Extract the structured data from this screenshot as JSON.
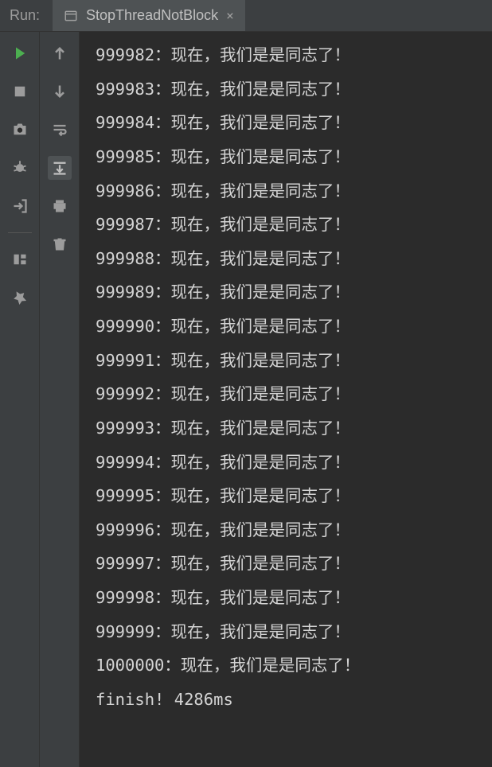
{
  "header": {
    "label": "Run:",
    "tab_title": "StopThreadNotBlock"
  },
  "console": {
    "lines": [
      "999982：现在，我们是是同志了！",
      "999983：现在，我们是是同志了！",
      "999984：现在，我们是是同志了！",
      "999985：现在，我们是是同志了！",
      "999986：现在，我们是是同志了！",
      "999987：现在，我们是是同志了！",
      "999988：现在，我们是是同志了！",
      "999989：现在，我们是是同志了！",
      "999990：现在，我们是是同志了！",
      "999991：现在，我们是是同志了！",
      "999992：现在，我们是是同志了！",
      "999993：现在，我们是是同志了！",
      "999994：现在，我们是是同志了！",
      "999995：现在，我们是是同志了！",
      "999996：现在，我们是是同志了！",
      "999997：现在，我们是是同志了！",
      "999998：现在，我们是是同志了！",
      "999999：现在，我们是是同志了！",
      "1000000：现在，我们是是同志了！",
      "finish! 4286ms"
    ]
  }
}
